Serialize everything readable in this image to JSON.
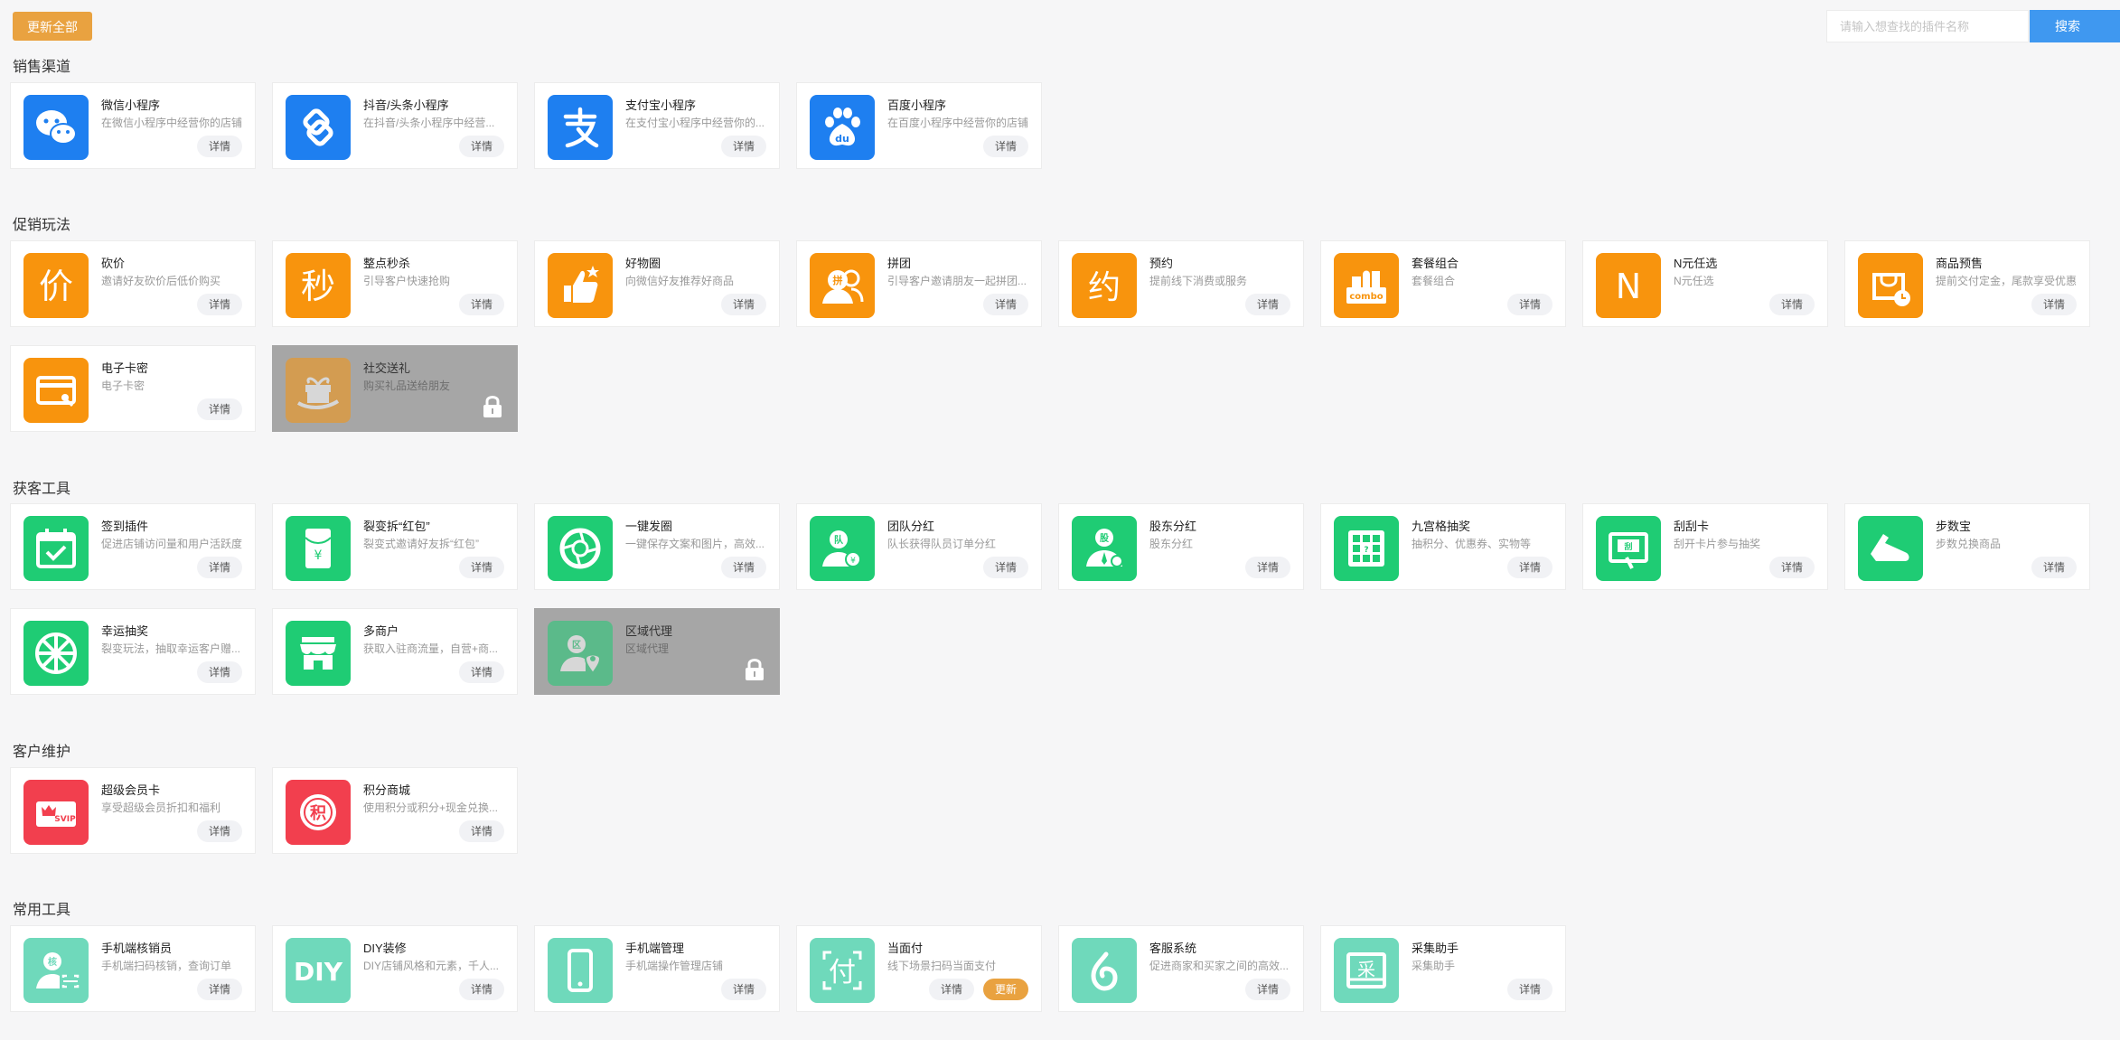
{
  "toolbar": {
    "update_all_label": "更新全部",
    "search_placeholder": "请输入想查找的插件名称",
    "search_label": "搜索"
  },
  "colors": {
    "sales": "#1e7ff0",
    "promo": "#f8940d",
    "acquire": "#1fcc74",
    "retain": "#f23f4e",
    "common": "#6fd9bb",
    "update": "#e9a240",
    "primary": "#3f98f0"
  },
  "sections": [
    {
      "title": "销售渠道",
      "items": [
        {
          "name": "微信小程序",
          "desc": "在微信小程序中经营你的店铺",
          "detail": "详情",
          "icon": "wechat-icon"
        },
        {
          "name": "抖音/头条小程序",
          "desc": "在抖音/头条小程序中经营...",
          "detail": "详情",
          "icon": "douyin-icon"
        },
        {
          "name": "支付宝小程序",
          "desc": "在支付宝小程序中经营你的...",
          "detail": "详情",
          "icon": "alipay-icon"
        },
        {
          "name": "百度小程序",
          "desc": "在百度小程序中经营你的店铺",
          "detail": "详情",
          "icon": "baidu-icon"
        }
      ]
    },
    {
      "title": "促销玩法",
      "items": [
        {
          "name": "砍价",
          "desc": "邀请好友砍价后低价购买",
          "detail": "详情",
          "icon": "bargain-icon",
          "glyph": "价"
        },
        {
          "name": "整点秒杀",
          "desc": "引导客户快速抢购",
          "detail": "详情",
          "icon": "flash-sale-icon",
          "glyph": "秒"
        },
        {
          "name": "好物圈",
          "desc": "向微信好友推荐好商品",
          "detail": "详情",
          "icon": "thumbs-up-icon"
        },
        {
          "name": "拼团",
          "desc": "引导客户邀请朋友一起拼团...",
          "detail": "详情",
          "icon": "group-buy-icon"
        },
        {
          "name": "预约",
          "desc": "提前线下消费或服务",
          "detail": "详情",
          "icon": "reservation-icon",
          "glyph": "约"
        },
        {
          "name": "套餐组合",
          "desc": "套餐组合",
          "detail": "详情",
          "icon": "combo-icon",
          "glyph": "combo"
        },
        {
          "name": "N元任选",
          "desc": "N元任选",
          "detail": "详情",
          "icon": "n-choice-icon",
          "glyph": "N"
        },
        {
          "name": "商品预售",
          "desc": "提前交付定金，尾款享受优惠",
          "detail": "详情",
          "icon": "presale-bag-icon"
        },
        {
          "name": "电子卡密",
          "desc": "电子卡密",
          "detail": "详情",
          "icon": "e-card-icon"
        },
        {
          "name": "社交送礼",
          "desc": "购买礼品送给朋友",
          "locked": true,
          "icon": "gift-icon"
        }
      ]
    },
    {
      "title": "获客工具",
      "items": [
        {
          "name": "签到插件",
          "desc": "促进店铺访问量和用户活跃度",
          "detail": "详情",
          "icon": "calendar-check-icon"
        },
        {
          "name": "裂变拆“红包”",
          "desc": "裂变式邀请好友拆“红包”",
          "detail": "详情",
          "icon": "red-envelope-icon"
        },
        {
          "name": "一键发圈",
          "desc": "一键保存文案和图片，高效...",
          "detail": "详情",
          "icon": "aperture-icon"
        },
        {
          "name": "团队分红",
          "desc": "队长获得队员订单分红",
          "detail": "详情",
          "icon": "team-bonus-icon",
          "glyph": "队"
        },
        {
          "name": "股东分红",
          "desc": "股东分红",
          "detail": "详情",
          "icon": "shareholder-icon",
          "glyph": "股"
        },
        {
          "name": "九宫格抽奖",
          "desc": "抽积分、优惠券、实物等",
          "detail": "详情",
          "icon": "grid-lottery-icon"
        },
        {
          "name": "刮刮卡",
          "desc": "刮开卡片参与抽奖",
          "detail": "详情",
          "icon": "scratch-card-icon",
          "glyph": "刮"
        },
        {
          "name": "步数宝",
          "desc": "步数兑换商品",
          "detail": "详情",
          "icon": "sneaker-icon"
        },
        {
          "name": "幸运抽奖",
          "desc": "裂变玩法，抽取幸运客户赠...",
          "detail": "详情",
          "icon": "lucky-wheel-icon"
        },
        {
          "name": "多商户",
          "desc": "获取入驻商流量，自营+商...",
          "detail": "详情",
          "icon": "storefront-icon"
        },
        {
          "name": "区域代理",
          "desc": "区域代理",
          "locked": true,
          "icon": "region-agent-icon",
          "glyph": "区"
        }
      ]
    },
    {
      "title": "客户维护",
      "items": [
        {
          "name": "超级会员卡",
          "desc": "享受超级会员折扣和福利",
          "detail": "详情",
          "icon": "svip-card-icon",
          "glyph": "SVIP"
        },
        {
          "name": "积分商城",
          "desc": "使用积分或积分+现金兑换...",
          "detail": "详情",
          "icon": "points-mall-icon",
          "glyph": "积"
        }
      ]
    },
    {
      "title": "常用工具",
      "items": [
        {
          "name": "手机端核销员",
          "desc": "手机端扫码核销，查询订单",
          "detail": "详情",
          "icon": "verifier-icon",
          "glyph": "核"
        },
        {
          "name": "DIY装修",
          "desc": "DIY店铺风格和元素，千人...",
          "detail": "详情",
          "icon": "diy-icon",
          "glyph": "DIY"
        },
        {
          "name": "手机端管理",
          "desc": "手机端操作管理店铺",
          "detail": "详情",
          "icon": "mobile-phone-icon"
        },
        {
          "name": "当面付",
          "desc": "线下场景扫码当面支付",
          "detail": "详情",
          "update": "更新",
          "icon": "face-pay-icon",
          "glyph": "付"
        },
        {
          "name": "客服系统",
          "desc": "促进商家和买家之间的高效...",
          "detail": "详情",
          "icon": "customer-service-icon"
        },
        {
          "name": "采集助手",
          "desc": "采集助手",
          "detail": "详情",
          "icon": "collector-icon",
          "glyph": "采"
        }
      ]
    }
  ]
}
